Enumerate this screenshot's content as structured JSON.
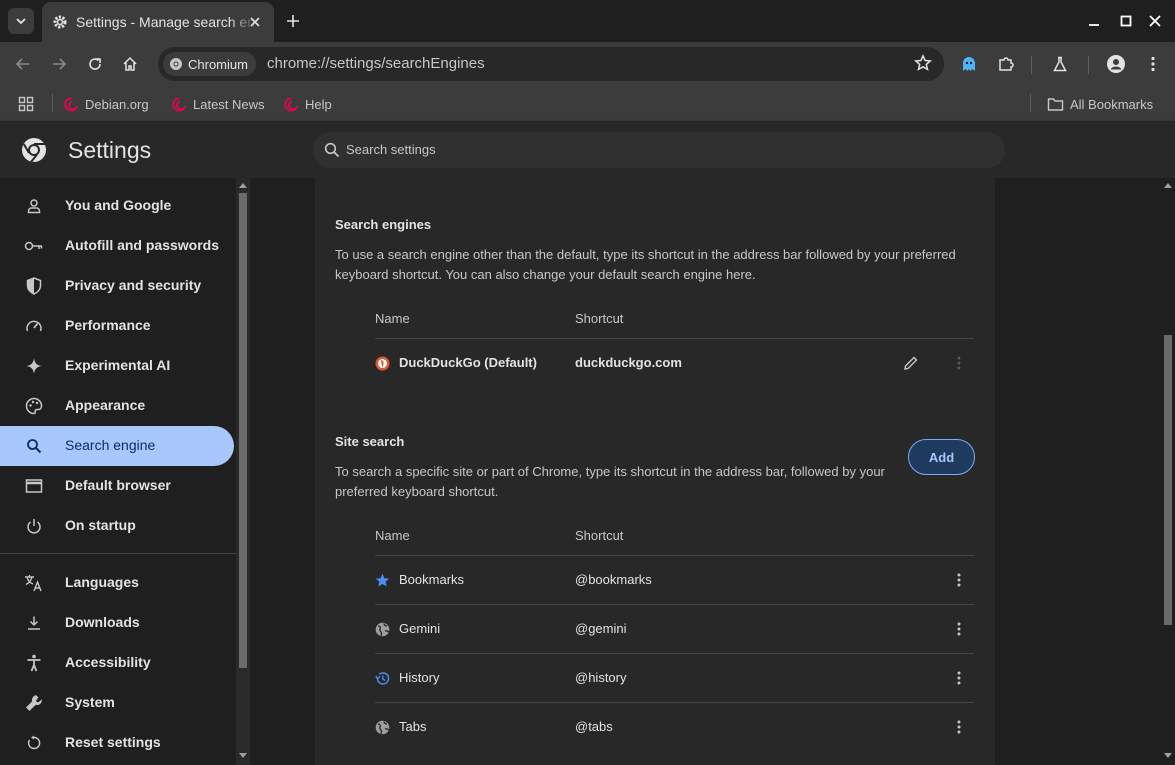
{
  "browser": {
    "tab_title": "Settings - Manage search engines",
    "brand_chip": "Chromium",
    "url": "chrome://settings/searchEngines"
  },
  "bookmarks": {
    "items": [
      {
        "label": "Debian.org"
      },
      {
        "label": "Latest News"
      },
      {
        "label": "Help"
      }
    ],
    "all_label": "All Bookmarks"
  },
  "settings": {
    "title": "Settings",
    "search_placeholder": "Search settings"
  },
  "sidebar": {
    "items": [
      {
        "label": "You and Google",
        "icon": "person-icon"
      },
      {
        "label": "Autofill and passwords",
        "icon": "key-icon"
      },
      {
        "label": "Privacy and security",
        "icon": "shield-icon"
      },
      {
        "label": "Performance",
        "icon": "speedometer-icon"
      },
      {
        "label": "Experimental AI",
        "icon": "sparkle-icon"
      },
      {
        "label": "Appearance",
        "icon": "palette-icon"
      },
      {
        "label": "Search engine",
        "icon": "search-icon",
        "active": true
      },
      {
        "label": "Default browser",
        "icon": "browser-window-icon"
      },
      {
        "label": "On startup",
        "icon": "power-icon"
      },
      {
        "label": "Languages",
        "icon": "translate-icon"
      },
      {
        "label": "Downloads",
        "icon": "download-icon"
      },
      {
        "label": "Accessibility",
        "icon": "accessibility-icon"
      },
      {
        "label": "System",
        "icon": "wrench-icon"
      },
      {
        "label": "Reset settings",
        "icon": "reset-icon"
      }
    ]
  },
  "search_engines": {
    "heading": "Search engines",
    "description_1": "To use a search engine other than the default, type its shortcut in the address bar followed by your preferred",
    "description_2": "keyboard shortcut. You can also change your default search engine here.",
    "col_name": "Name",
    "col_shortcut": "Shortcut",
    "rows": [
      {
        "name": "DuckDuckGo (Default)",
        "shortcut": "duckduckgo.com"
      }
    ]
  },
  "site_search": {
    "heading": "Site search",
    "description_1": "To search a specific site or part of Chrome, type its shortcut in the address bar, followed by your",
    "description_2": "preferred keyboard shortcut.",
    "add_label": "Add",
    "col_name": "Name",
    "col_shortcut": "Shortcut",
    "rows": [
      {
        "name": "Bookmarks",
        "shortcut": "@bookmarks",
        "icon": "star-icon"
      },
      {
        "name": "Gemini",
        "shortcut": "@gemini",
        "icon": "globe-icon"
      },
      {
        "name": "History",
        "shortcut": "@history",
        "icon": "history-icon"
      },
      {
        "name": "Tabs",
        "shortcut": "@tabs",
        "icon": "globe-icon"
      }
    ]
  },
  "colors": {
    "accent": "#a8c7fa",
    "active_text": "#062e6f",
    "surface": "#282828",
    "background": "#1f1f1f"
  }
}
